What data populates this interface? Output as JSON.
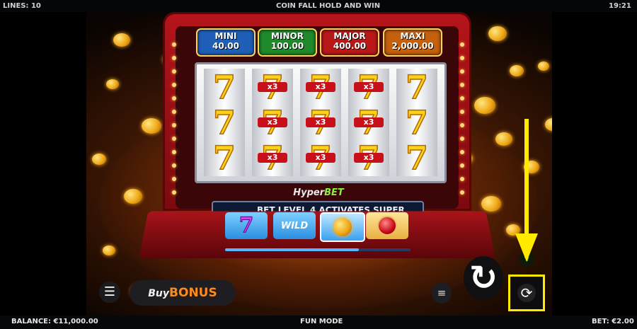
{
  "topbar": {
    "lines": "LINES: 10",
    "title": "COIN FALL HOLD AND WIN",
    "time": "19:21"
  },
  "jackpots": [
    {
      "label": "MINI",
      "value": "40.00",
      "color": "#1f5fb8"
    },
    {
      "label": "MINOR",
      "value": "100.00",
      "color": "#1e8a2a"
    },
    {
      "label": "MAJOR",
      "value": "400.00",
      "color": "#b81818"
    },
    {
      "label": "MAXI",
      "value": "2,000.00",
      "color": "#c4600e"
    }
  ],
  "reels": [
    [
      "seven",
      "seven",
      "seven"
    ],
    [
      "x3",
      "x3",
      "x3"
    ],
    [
      "x3",
      "x3",
      "x3"
    ],
    [
      "x3",
      "x3",
      "x3"
    ],
    [
      "seven",
      "seven",
      "seven"
    ]
  ],
  "multiplier_label": "x3",
  "hyperbet": {
    "part1": "Hyper",
    "part2": "BET",
    "ticker": "BET LEVEL 4 ACTIVATES SUPER"
  },
  "features": {
    "wild": "WILD",
    "progress": 0.72
  },
  "controls": {
    "buy_part1": "Buy",
    "buy_part2": "BONUS"
  },
  "bottombar": {
    "balance": "BALANCE: €11,000.00",
    "mode": "FUN MODE",
    "bet": "BET: €2.00"
  },
  "annotation_color": "#ffea00"
}
